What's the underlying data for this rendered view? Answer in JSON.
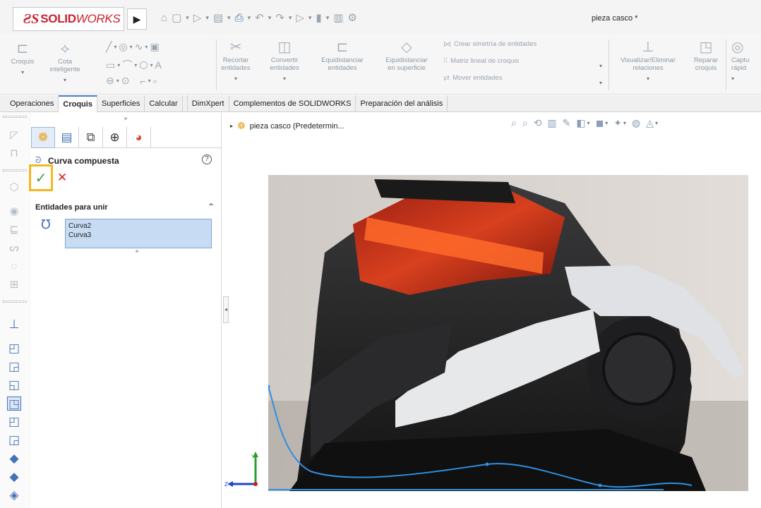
{
  "app": {
    "logo_ds": "ƧS",
    "logo_solid": "SOLID",
    "logo_works": "WORKS",
    "menu_arrow": "▶",
    "document_title": "pieza casco *"
  },
  "quick_access": [
    {
      "icon": "home-icon",
      "glyph": "⌂"
    },
    {
      "icon": "new-document-icon",
      "glyph": "▢"
    },
    {
      "icon": "open-icon",
      "glyph": "▷"
    },
    {
      "icon": "save-icon",
      "glyph": "▤"
    },
    {
      "icon": "print-icon",
      "glyph": "⎙"
    },
    {
      "icon": "undo-icon",
      "glyph": "↶"
    },
    {
      "icon": "redo-icon",
      "glyph": "↷"
    },
    {
      "icon": "select-icon",
      "glyph": "▷"
    },
    {
      "icon": "rebuild-icon",
      "glyph": "▮"
    },
    {
      "icon": "file-properties-icon",
      "glyph": "▥"
    },
    {
      "icon": "options-gear-icon",
      "glyph": "⚙"
    }
  ],
  "ribbon": {
    "croquis": "Croquis",
    "cota_1": "Cota",
    "cota_2": "inteligente",
    "recortar_1": "Recortar",
    "recortar_2": "entidades",
    "convertir_1": "Convertir",
    "convertir_2": "entidades",
    "equid1_1": "Equidistanciar",
    "equid1_2": "entidades",
    "equid2_1": "Equidistanciar",
    "equid2_2": "en superficie",
    "simetria": "Crear simetría de entidades",
    "matriz": "Matriz lineal de croquis",
    "mover": "Mover entidades",
    "visualizar_1": "Visualizar/Eliminar",
    "visualizar_2": "relaciones",
    "reparar_1": "Reparar",
    "reparar_2": "croquis",
    "captura_1": "Captu",
    "captura_2": "rápid"
  },
  "tabs": [
    {
      "label": "Operaciones",
      "active": false
    },
    {
      "label": "Croquis",
      "active": true
    },
    {
      "label": "Superficies",
      "active": false
    },
    {
      "label": "Calcular",
      "active": false
    },
    {
      "label": "DimXpert",
      "active": false
    },
    {
      "label": "Complementos de SOLIDWORKS",
      "active": false
    },
    {
      "label": "Preparación del análisis",
      "active": false
    }
  ],
  "property_manager": {
    "title": "Curva compuesta",
    "help": "?",
    "ok": "✓",
    "cancel": "✕",
    "section_title": "Entidades para unir",
    "section_chevron": "⌃",
    "entities": [
      "Curva2",
      "Curva3"
    ]
  },
  "graphics": {
    "breadcrumb_arrow": "▸",
    "breadcrumb": "pieza casco  (Predetermin..."
  },
  "colors": {
    "accent_blue": "#4472b8",
    "ok_highlight": "#f2b81f",
    "ok_green": "#3aa53a",
    "cancel_red": "#d42828",
    "brand_red": "#c8202e",
    "sketch_curve": "#2f8fe0"
  }
}
